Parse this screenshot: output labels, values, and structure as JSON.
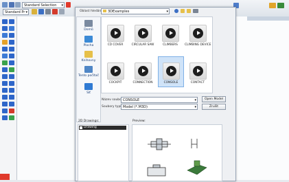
{
  "toolbar": {
    "selection_combo": "Standard Selection",
    "view_combo": "Standard Pr",
    "colors": {
      "red": "#e03a2c",
      "blue": "#2e66c9"
    }
  },
  "dialog": {
    "lookin_label": "Oblast hledání:",
    "lookin_value": "3DExamples",
    "places": [
      {
        "label": "Domů",
        "icon": "home-icon"
      },
      {
        "label": "Plocha",
        "icon": "desktop-icon"
      },
      {
        "label": "Knihovny",
        "icon": "libraries-icon"
      },
      {
        "label": "Tento počítač",
        "icon": "computer-icon"
      },
      {
        "label": "Síť",
        "icon": "network-icon"
      }
    ],
    "files": [
      {
        "name": "CD COVER",
        "selected": false
      },
      {
        "name": "CIRCULAR SAW",
        "selected": false
      },
      {
        "name": "CLIMBERS",
        "selected": false
      },
      {
        "name": "CLIMBING DEVICE",
        "selected": false
      },
      {
        "name": "COCKPIT",
        "selected": false
      },
      {
        "name": "CONNECTION",
        "selected": false
      },
      {
        "name": "CONSOLE",
        "selected": true
      },
      {
        "name": "CONTACT",
        "selected": false
      }
    ],
    "filename_label": "Název souboru:",
    "filename_value": "CONSOLE",
    "filetype_label": "Soubory typu:",
    "filetype_value": "Model (*.M3D)",
    "open_button": "Open Model",
    "cancel_button": "Zrušit",
    "drawings_title": "2D Drawings:",
    "drawings_item": "Drawing",
    "preview_title": "Preview:"
  }
}
